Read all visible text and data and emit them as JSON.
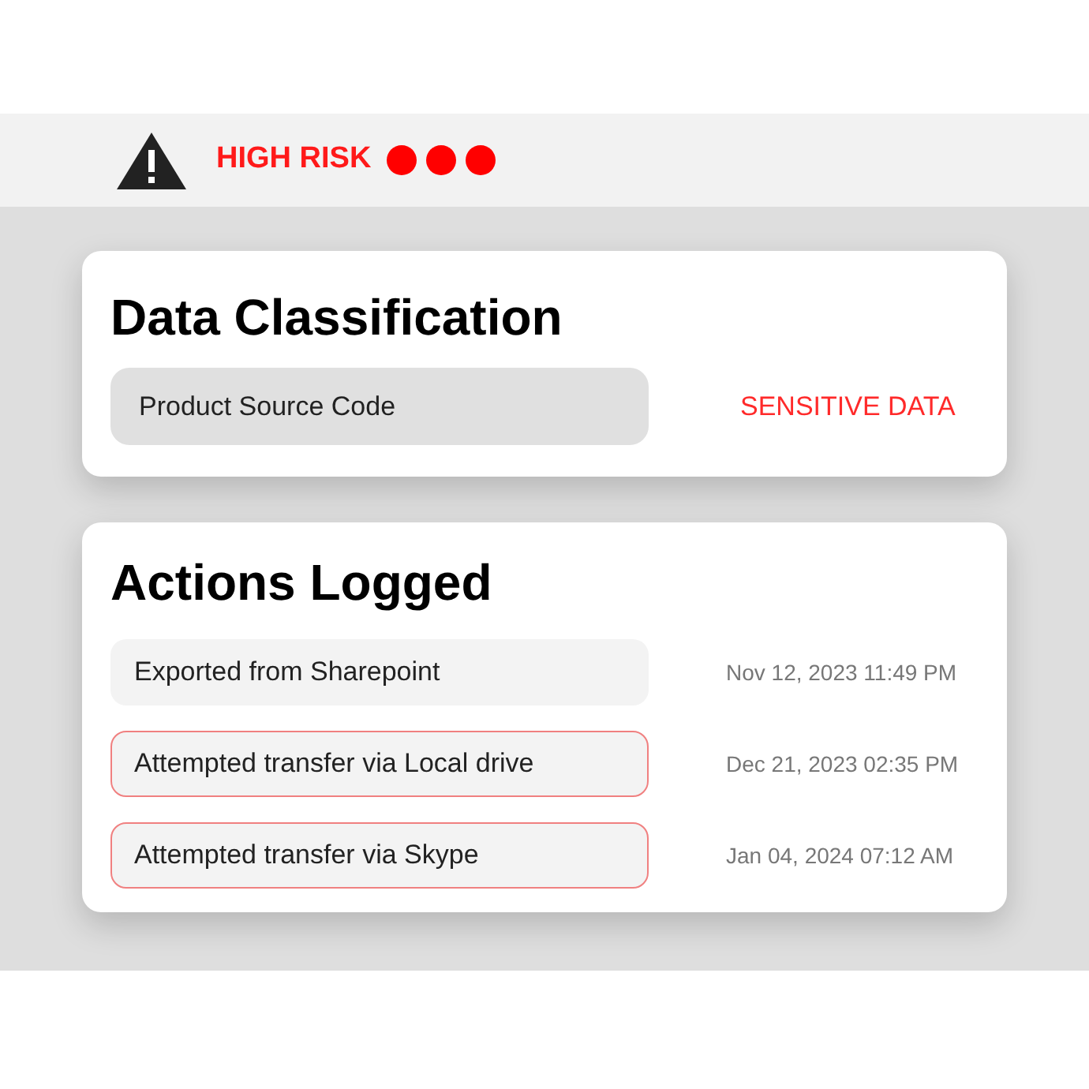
{
  "risk_banner": {
    "label": "HIGH RISK",
    "dots": [
      {
        "color": "#ff0000"
      },
      {
        "color": "#ff0000"
      },
      {
        "color": "#ff0000"
      }
    ]
  },
  "data_classification": {
    "title": "Data Classification",
    "value": "Product Source Code",
    "tag": "SENSITIVE DATA"
  },
  "actions_logged": {
    "title": "Actions Logged",
    "rows": [
      {
        "action": "Exported from Sharepoint",
        "time": "Nov 12, 2023 11:49 PM",
        "flagged": false
      },
      {
        "action": "Attempted transfer via Local drive",
        "time": "Dec 21, 2023 02:35 PM",
        "flagged": true
      },
      {
        "action": "Attempted transfer via Skype",
        "time": "Jan 04, 2024 07:12 AM",
        "flagged": true
      }
    ]
  }
}
